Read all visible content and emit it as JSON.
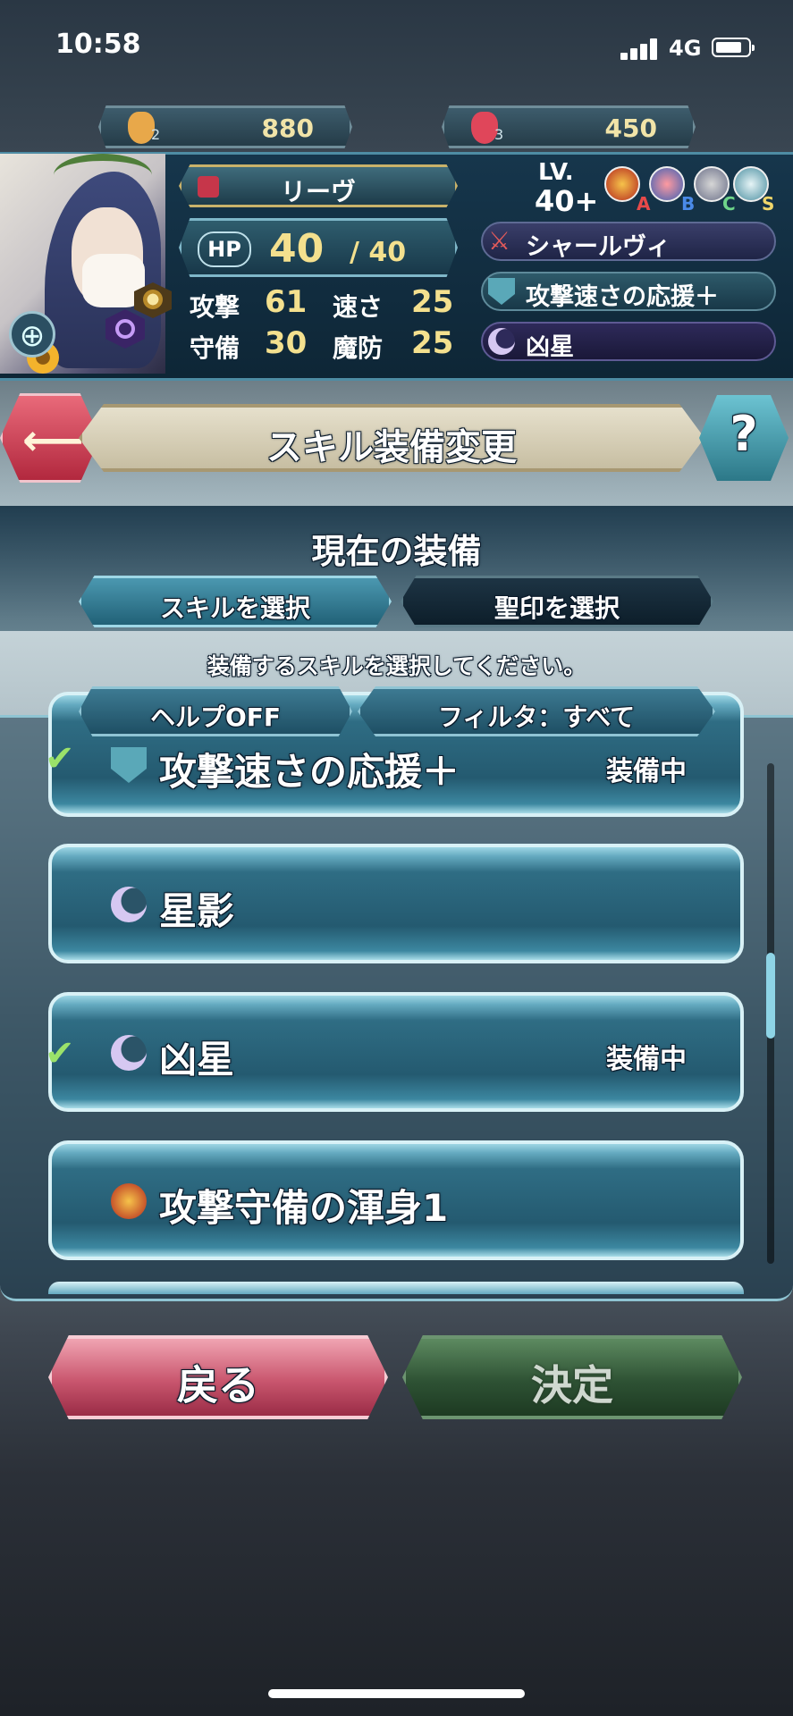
{
  "status_bar": {
    "time": "10:58",
    "network": "4G"
  },
  "currency": [
    {
      "tier": "2",
      "value": "880",
      "color": "#e8a84a"
    },
    {
      "tier": "3",
      "value": "450",
      "color": "#e0465a"
    }
  ],
  "hero": {
    "name": "リーヴ",
    "hp_label": "HP",
    "hp_current": "40",
    "hp_max": "/ 40",
    "stats": [
      {
        "label": "攻撃",
        "value": "61"
      },
      {
        "label": "速さ",
        "value": "25"
      },
      {
        "label": "守備",
        "value": "30"
      },
      {
        "label": "魔防",
        "value": "25"
      }
    ],
    "lv_label": "LV.",
    "lv_value": "40+",
    "skill_slots": [
      "A",
      "B",
      "C",
      "S"
    ],
    "equipped": [
      {
        "icon": "sword-icon",
        "name": "シャールヴィ"
      },
      {
        "icon": "shield-icon",
        "name": "攻撃速さの応援＋"
      },
      {
        "icon": "moon-icon",
        "name": "凶星"
      }
    ]
  },
  "header": {
    "title": "スキル装備変更",
    "help": "?"
  },
  "panel": {
    "title": "現在の装備",
    "tabs": [
      "スキルを選択",
      "聖印を選択"
    ],
    "instruction": "装備するスキルを選択してください。",
    "help_toggle": "ヘルプOFF",
    "filter": "フィルタ：すべて"
  },
  "skills": [
    {
      "name": "攻撃速さの応援＋",
      "status": "装備中",
      "checked": true,
      "icon": "shield-icon"
    },
    {
      "name": "星影",
      "status": "",
      "checked": false,
      "icon": "moon-icon"
    },
    {
      "name": "凶星",
      "status": "装備中",
      "checked": true,
      "icon": "moon-icon"
    },
    {
      "name": "攻撃守備の渾身1",
      "status": "",
      "checked": false,
      "icon": "skill-a-icon"
    }
  ],
  "buttons": {
    "back": "戻る",
    "confirm": "決定"
  },
  "colors": {
    "accent": "#8ed4e6",
    "gold": "#f4e08e",
    "check": "#9be26a"
  }
}
